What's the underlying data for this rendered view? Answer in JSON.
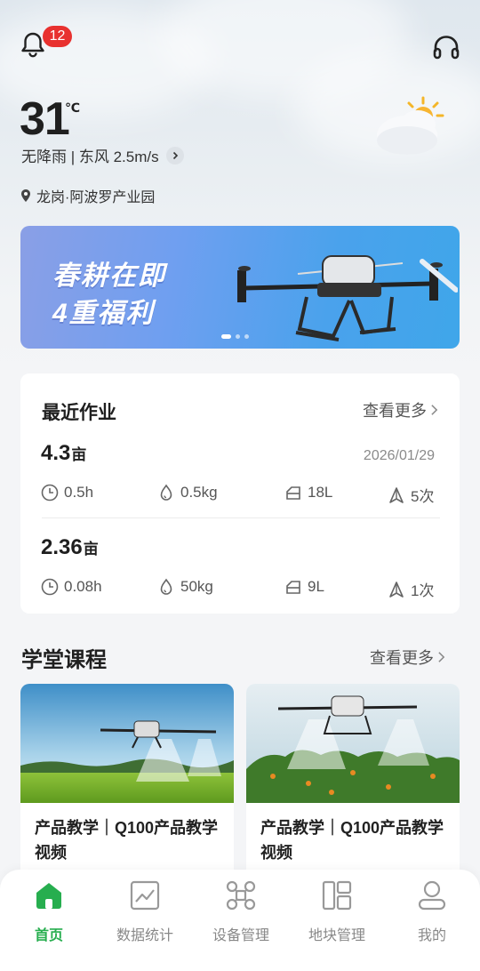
{
  "header": {
    "notification_count": "12",
    "bell_icon": "bell-icon",
    "support_icon": "headset-icon"
  },
  "weather": {
    "temperature": "31",
    "unit": "℃",
    "condition": "无降雨 | 东风 2.5m/s",
    "icon": "partly-cloudy-icon"
  },
  "location": {
    "text": "龙岗·阿波罗产业园",
    "icon": "location-pin-icon"
  },
  "banner": {
    "line1": "春耕在即",
    "line2": "4重福利",
    "slide_count": 3,
    "active_slide": 1
  },
  "recent_work": {
    "title": "最近作业",
    "more_label": "查看更多",
    "records": [
      {
        "area": "4.3",
        "area_unit": "亩",
        "date": "2026/01/29",
        "duration": "0.5h",
        "dosage": "0.5kg",
        "volume": "18L",
        "flights": "5次"
      },
      {
        "area": "2.36",
        "area_unit": "亩",
        "date": "",
        "duration": "0.08h",
        "dosage": "50kg",
        "volume": "9L",
        "flights": "1次"
      }
    ]
  },
  "courses": {
    "title": "学堂课程",
    "more_label": "查看更多",
    "items": [
      {
        "title": "产品教学｜Q100产品教学视频"
      },
      {
        "title": "产品教学｜Q100产品教学视频"
      }
    ]
  },
  "nav": {
    "items": [
      {
        "label": "首页",
        "icon": "home-icon",
        "active": true
      },
      {
        "label": "数据统计",
        "icon": "chart-icon",
        "active": false
      },
      {
        "label": "设备管理",
        "icon": "drone-icon",
        "active": false
      },
      {
        "label": "地块管理",
        "icon": "map-blocks-icon",
        "active": false
      },
      {
        "label": "我的",
        "icon": "user-icon",
        "active": false
      }
    ]
  },
  "colors": {
    "accent_green": "#27ae4f",
    "badge_red": "#e8312f",
    "banner_blue": "#4aa2ec"
  }
}
